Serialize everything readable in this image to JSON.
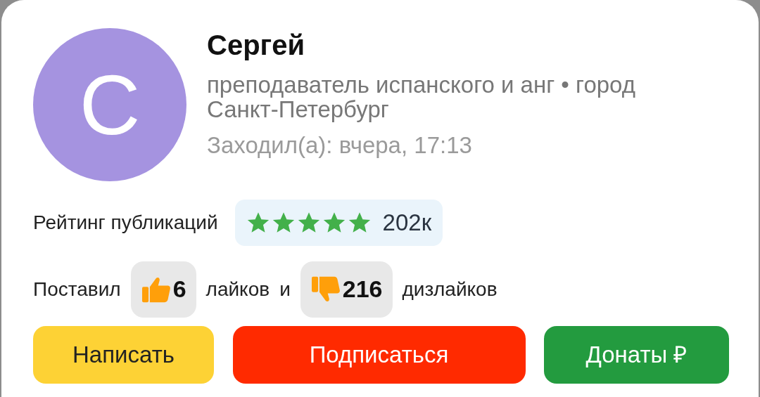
{
  "profile": {
    "avatar_letter": "С",
    "name": "Сергей",
    "subtitle": "преподаватель испанского и анг • город Санкт-Петербург",
    "last_seen": "Заходил(а): вчера, 17:13"
  },
  "rating": {
    "label": "Рейтинг публикаций",
    "stars": 5,
    "count": "202к"
  },
  "reactions": {
    "prefix": "Поставил",
    "likes": "6",
    "likes_label": "лайков",
    "joiner": "и",
    "dislikes": "216",
    "dislikes_label": "дизлайков"
  },
  "buttons": [
    {
      "label": "Написать",
      "kind": "write"
    },
    {
      "label": "Подписаться",
      "kind": "subscribe"
    },
    {
      "label": "Донаты ₽",
      "kind": "donate"
    }
  ]
}
